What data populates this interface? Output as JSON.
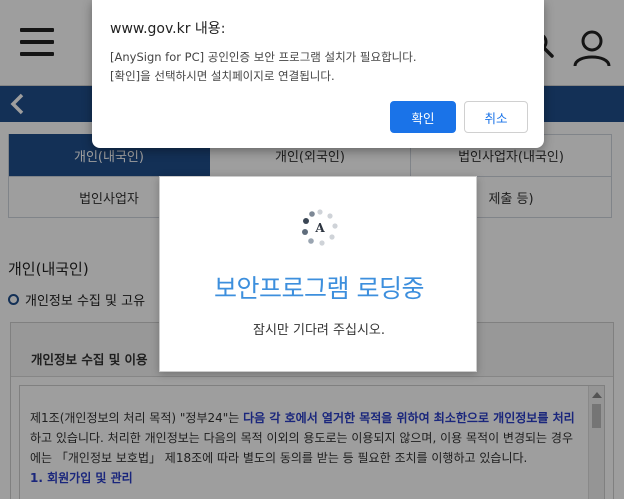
{
  "dialog": {
    "title": "www.gov.kr 내용:",
    "message_line1": "[AnySign for PC] 공인인증 보안 프로그램 설치가 필요합니다.",
    "message_line2": "[확인]을 선택하시면 설치페이지로 연결됩니다.",
    "ok_label": "확인",
    "cancel_label": "취소",
    "accent_color": "#1a73e8"
  },
  "loader": {
    "title": "보안프로그램 로딩중",
    "subtitle": "잠시만 기다려 주십시오.",
    "spinner_letter": "A",
    "title_color": "#3d8fdd"
  },
  "header": {
    "menu_icon": "hamburger-icon",
    "search_icon": "search-icon",
    "user_icon": "user-icon",
    "back_icon": "chevron-left-icon",
    "bar_color": "#1f4e8c"
  },
  "tabs": {
    "row1": [
      "개인(내국인)",
      "개인(외국인)",
      "법인사업자(내국인)"
    ],
    "row2": [
      "법인사업자",
      "",
      "제출 등)"
    ],
    "active_index": 0
  },
  "section": {
    "title": "개인(내국인)",
    "bullet": "개인정보 수집 및 고유"
  },
  "doc": {
    "header": "개인정보 수집 및 이용",
    "p1_a": "제1조(개인정보의 처리 목적) \"정부24\"는 ",
    "p1_b": "다음 각 호에서 열거한 목적을 위하여 최소한으로 개인정보를 처리",
    "p1_c": "하고 있습니다. 처리한 개인정보는 다음의 목적 이외의 용도로는 이용되지 않으며, 이용 목적이 변경되는 경우에는 「개인정보 보호법」 제18조에 따라 별도의 동의를 받는 등 필요한 조치를 이행하고 있습니다.",
    "item1": "1. 회원가입 및 관리"
  }
}
